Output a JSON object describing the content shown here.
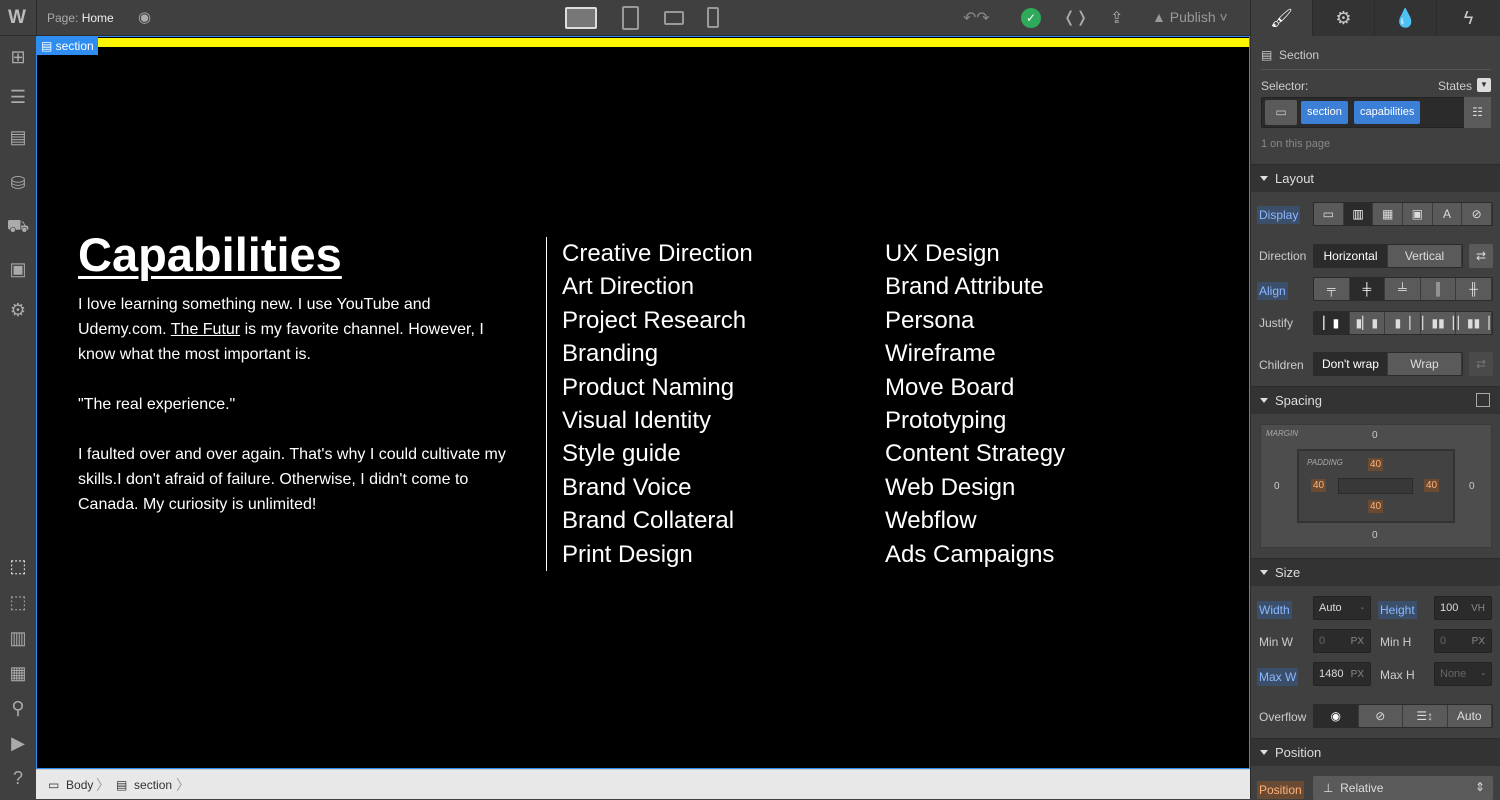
{
  "topbar": {
    "logo": "W",
    "page_label": "Page:",
    "page_name": "Home",
    "publish_label": "Publish",
    "devices": [
      "desktop",
      "tablet",
      "mobile-landscape",
      "mobile-portrait"
    ]
  },
  "canvas": {
    "selected_tag": "section",
    "heading": "Capabilities",
    "para1_a": "I love learning something new. I use YouTube and Udemy.com. ",
    "para1_link": "The Futur",
    "para1_b": " is my favorite channel. However, I know what the most important is.",
    "para2": "\"The real experience.\"",
    "para3": "I faulted over and over again. That's why I could cultivate my skills.I don't afraid of failure. Otherwise, I didn't come to Canada. My curiosity is unlimited!",
    "col1": [
      "Creative Direction",
      "Art Direction",
      "Project Research",
      "Branding",
      "Product Naming",
      "Visual Identity",
      "Style guide",
      "Brand Voice",
      "Brand Collateral",
      "Print Design"
    ],
    "col2": [
      "UX Design",
      "Brand Attribute",
      "Persona",
      "Wireframe",
      "Move Board",
      "Prototyping",
      "Content Strategy",
      "Web Design",
      "Webflow",
      "Ads Campaigns"
    ],
    "highlight_color": "#fff700",
    "selection_color": "#2f8cf0"
  },
  "breadcrumb": [
    "Body",
    "section"
  ],
  "panel": {
    "element_type": "Section",
    "selector_label": "Selector:",
    "states_label": "States",
    "classes": [
      "section",
      "capabilities"
    ],
    "count_text": "1 on this page",
    "layout": {
      "title": "Layout",
      "display_label": "Display",
      "display_selected": "flex",
      "direction_label": "Direction",
      "direction_options": [
        "Horizontal",
        "Vertical"
      ],
      "direction_selected": "Horizontal",
      "align_label": "Align",
      "justify_label": "Justify",
      "children_label": "Children",
      "children_options": [
        "Don't wrap",
        "Wrap"
      ],
      "children_selected": "Don't wrap"
    },
    "spacing": {
      "title": "Spacing",
      "margin_label": "MARGIN",
      "padding_label": "PADDING",
      "margin": {
        "top": "0",
        "right": "0",
        "bottom": "0",
        "left": "0"
      },
      "padding": {
        "top": "40",
        "right": "40",
        "bottom": "40",
        "left": "40"
      }
    },
    "size": {
      "title": "Size",
      "width_label": "Width",
      "width": "Auto",
      "width_unit": "-",
      "height_label": "Height",
      "height": "100",
      "height_unit": "VH",
      "minw_label": "Min W",
      "minw": "0",
      "minw_unit": "PX",
      "minh_label": "Min H",
      "minh": "0",
      "minh_unit": "PX",
      "maxw_label": "Max W",
      "maxw": "1480",
      "maxw_unit": "PX",
      "maxh_label": "Max H",
      "maxh": "None",
      "maxh_unit": "-",
      "overflow_label": "Overflow",
      "overflow_auto": "Auto"
    },
    "position": {
      "title": "Position",
      "label": "Position",
      "value": "Relative"
    }
  }
}
